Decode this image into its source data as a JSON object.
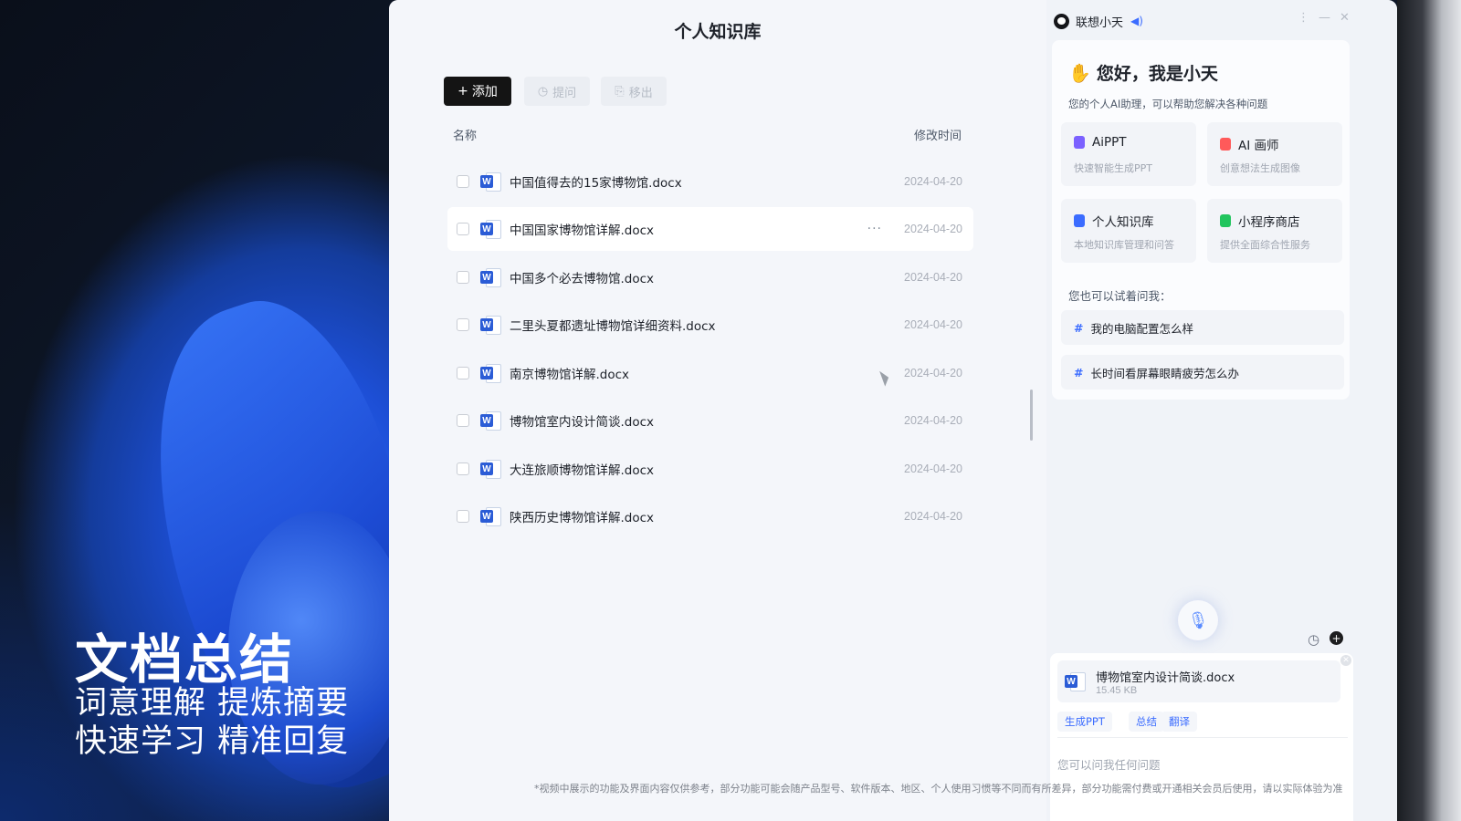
{
  "overlay": {
    "title": "文档总结",
    "line1": "词意理解 提炼摘要",
    "line2": "快速学习 精准回复"
  },
  "kb": {
    "title": "个人知识库",
    "toolbar": {
      "add_label": "添加",
      "ask_label": "提问",
      "remove_label": "移出"
    },
    "columns": {
      "name": "名称",
      "time": "修改时间"
    },
    "files": [
      {
        "name": "中国值得去的15家博物馆.docx",
        "date": "2024-04-20"
      },
      {
        "name": "中国国家博物馆详解.docx",
        "date": "2024-04-20",
        "more": "···"
      },
      {
        "name": "中国多个必去博物馆.docx",
        "date": "2024-04-20"
      },
      {
        "name": "二里头夏都遗址博物馆详细资料.docx",
        "date": "2024-04-20"
      },
      {
        "name": "南京博物馆详解.docx",
        "date": "2024-04-20"
      },
      {
        "name": "博物馆室内设计简谈.docx",
        "date": "2024-04-20"
      },
      {
        "name": "大连旅顺博物馆详解.docx",
        "date": "2024-04-20"
      },
      {
        "name": "陕西历史博物馆详解.docx",
        "date": "2024-04-20"
      }
    ]
  },
  "assistant": {
    "name": "联想小天",
    "greeting": "您好，我是小天",
    "subtitle": "您的个人AI助理，可以帮助您解决各种问题",
    "features": [
      {
        "title": "AiPPT",
        "sub": "快速智能生成PPT",
        "color": "#7b61ff"
      },
      {
        "title": "AI 画师",
        "sub": "创意想法生成图像",
        "color": "#ff5a5a"
      },
      {
        "title": "个人知识库",
        "sub": "本地知识库管理和问答",
        "color": "#3b6cff"
      },
      {
        "title": "小程序商店",
        "sub": "提供全面综合性服务",
        "color": "#22c55e"
      }
    ],
    "try_label": "您也可以试着问我：",
    "suggestions": [
      {
        "hash": "#",
        "text": "我的电脑配置怎么样"
      },
      {
        "hash": "#",
        "text": "长时间看屏幕眼睛疲劳怎么办"
      }
    ],
    "attachment": {
      "name": "博物馆室内设计简谈.docx",
      "size": "15.45 KB"
    },
    "chips": [
      "生成PPT",
      "总结",
      "翻译"
    ],
    "input_placeholder": "您可以问我任何问题"
  },
  "disclaimer": "*视频中展示的功能及界面内容仅供参考，部分功能可能会随产品型号、软件版本、地区、个人使用习惯等不同而有所差异，部分功能需付费或开通相关会员后使用，请以实际体验为准"
}
